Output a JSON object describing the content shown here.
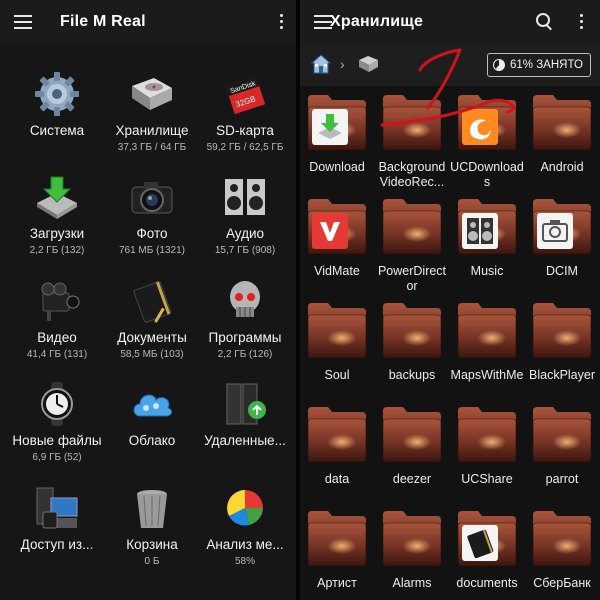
{
  "left": {
    "title": "File M Real",
    "categories": [
      {
        "name": "Система",
        "sub": "",
        "icon": "system-gear-icon"
      },
      {
        "name": "Хранилище",
        "sub": "37,3 ГБ / 64 ГБ",
        "icon": "hard-drive-icon"
      },
      {
        "name": "SD-карта",
        "sub": "59,2 ГБ / 62,5 ГБ",
        "icon": "sd-card-icon"
      },
      {
        "name": "Загрузки",
        "sub": "2,2 ГБ (132)",
        "icon": "downloads-icon"
      },
      {
        "name": "Фото",
        "sub": "761 МБ (1321)",
        "icon": "camera-icon"
      },
      {
        "name": "Аудио",
        "sub": "15,7 ГБ (908)",
        "icon": "speakers-icon"
      },
      {
        "name": "Видео",
        "sub": "41,4 ГБ (131)",
        "icon": "video-camera-icon"
      },
      {
        "name": "Документы",
        "sub": "58,5 МБ (103)",
        "icon": "notebook-icon"
      },
      {
        "name": "Программы",
        "sub": "2,2 ГБ (126)",
        "icon": "robot-skull-icon"
      },
      {
        "name": "Новые файлы",
        "sub": "6,9 ГБ (52)",
        "icon": "watch-icon"
      },
      {
        "name": "Облако",
        "sub": "",
        "icon": "cloud-icon"
      },
      {
        "name": "Удаленные...",
        "sub": "",
        "icon": "network-icon"
      },
      {
        "name": "Доступ из...",
        "sub": "",
        "icon": "devices-icon"
      },
      {
        "name": "Корзина",
        "sub": "0 Б",
        "icon": "trash-icon"
      },
      {
        "name": "Анализ ме...",
        "sub": "58%",
        "icon": "pie-chart-icon"
      }
    ]
  },
  "right": {
    "title": "Хранилище",
    "usage": "61% ЗАНЯТО",
    "usage_fraction": 0.61,
    "folders": [
      {
        "label": "Download",
        "overlay": "download"
      },
      {
        "label": "Background VideoRec...",
        "overlay": ""
      },
      {
        "label": "UCDownloads",
        "overlay": "uc"
      },
      {
        "label": "Android",
        "overlay": ""
      },
      {
        "label": "VidMate",
        "overlay": "vidmate"
      },
      {
        "label": "PowerDirector",
        "overlay": ""
      },
      {
        "label": "Music",
        "overlay": "music"
      },
      {
        "label": "DCIM",
        "overlay": "camera"
      },
      {
        "label": "Soul",
        "overlay": ""
      },
      {
        "label": "backups",
        "overlay": ""
      },
      {
        "label": "MapsWithMe",
        "overlay": ""
      },
      {
        "label": "BlackPlayer",
        "overlay": ""
      },
      {
        "label": "data",
        "overlay": ""
      },
      {
        "label": "deezer",
        "overlay": ""
      },
      {
        "label": "UCShare",
        "overlay": ""
      },
      {
        "label": "parrot",
        "overlay": ""
      },
      {
        "label": "Артист",
        "overlay": ""
      },
      {
        "label": "Alarms",
        "overlay": ""
      },
      {
        "label": "documents",
        "overlay": "documents"
      },
      {
        "label": "СберБанк",
        "overlay": ""
      }
    ]
  }
}
